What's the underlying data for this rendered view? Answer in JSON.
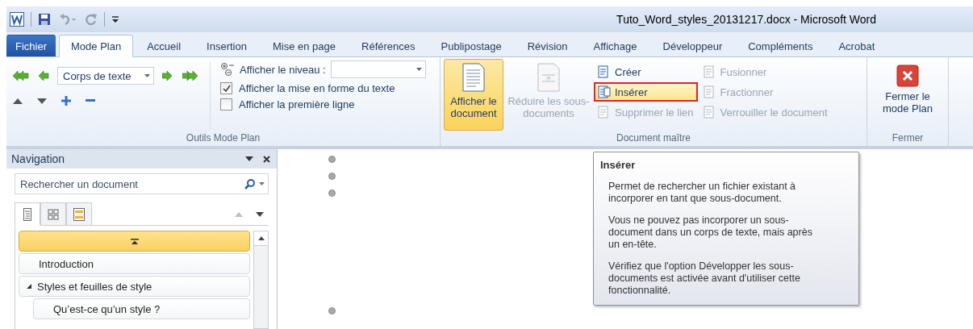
{
  "window": {
    "title": "Tuto_Word_styles_20131217.docx - Microsoft Word"
  },
  "tabs": [
    {
      "label": "Fichier",
      "kind": "file",
      "selected": false
    },
    {
      "label": "Mode Plan",
      "kind": "tab",
      "selected": true
    },
    {
      "label": "Accueil",
      "kind": "tab",
      "selected": false
    },
    {
      "label": "Insertion",
      "kind": "tab",
      "selected": false
    },
    {
      "label": "Mise en page",
      "kind": "tab",
      "selected": false
    },
    {
      "label": "Références",
      "kind": "tab",
      "selected": false
    },
    {
      "label": "Publipostage",
      "kind": "tab",
      "selected": false
    },
    {
      "label": "Révision",
      "kind": "tab",
      "selected": false
    },
    {
      "label": "Affichage",
      "kind": "tab",
      "selected": false
    },
    {
      "label": "Développeur",
      "kind": "tab",
      "selected": false
    },
    {
      "label": "Compléments",
      "kind": "tab",
      "selected": false
    },
    {
      "label": "Acrobat",
      "kind": "tab",
      "selected": false
    }
  ],
  "ribbon": {
    "outline_tools": {
      "label": "Outils Mode Plan",
      "level_dropdown": {
        "value": "Corps de texte"
      },
      "show_level": {
        "label": "Afficher le niveau :"
      },
      "checkboxes": [
        {
          "label": "Afficher la mise en forme du texte",
          "checked": true
        },
        {
          "label": "Afficher la première ligne",
          "checked": false
        }
      ]
    },
    "master_document": {
      "label": "Document maître",
      "large_buttons": [
        {
          "label": "Afficher le document",
          "selected": true,
          "disabled": false
        },
        {
          "label": "Réduire les sous-documents",
          "selected": false,
          "disabled": true
        }
      ],
      "columns": [
        [
          {
            "label": "Créer",
            "disabled": false,
            "highlighted": false,
            "framed": false
          },
          {
            "label": "Insérer",
            "disabled": false,
            "highlighted": true,
            "framed": true
          },
          {
            "label": "Supprimer le lien",
            "disabled": true,
            "highlighted": false,
            "framed": false
          }
        ],
        [
          {
            "label": "Fusionner",
            "disabled": true,
            "highlighted": false,
            "framed": false
          },
          {
            "label": "Fractionner",
            "disabled": true,
            "highlighted": false,
            "framed": false
          },
          {
            "label": "Verrouiller le document",
            "disabled": true,
            "highlighted": false,
            "framed": false
          }
        ]
      ]
    },
    "close": {
      "label": "Fermer",
      "button": {
        "label": "Fermer le mode Plan"
      }
    }
  },
  "navigation": {
    "title": "Navigation",
    "search": {
      "placeholder": "Rechercher un document"
    },
    "view_tabs": [
      {
        "selected": true
      },
      {
        "selected": false
      },
      {
        "selected": false
      }
    ],
    "top_item": {
      "selected": true
    },
    "headings": [
      {
        "label": "Introduction",
        "selected": false
      },
      {
        "label": "Styles et feuilles de style",
        "selected": false,
        "expanded": true,
        "children": [
          {
            "label": "Qu’est-ce qu’un style ?",
            "selected": false
          }
        ]
      }
    ]
  },
  "tooltip": {
    "title": "Insérer",
    "paragraphs": [
      "Permet de rechercher un fichier existant à incorporer en tant que sous-document.",
      "Vous ne pouvez pas incorporer un sous-document dans un corps de texte, mais après un en-tête.",
      "Vérifiez que l'option Développer les sous-documents est activée avant d'utiliser cette fonctionnalité."
    ]
  }
}
